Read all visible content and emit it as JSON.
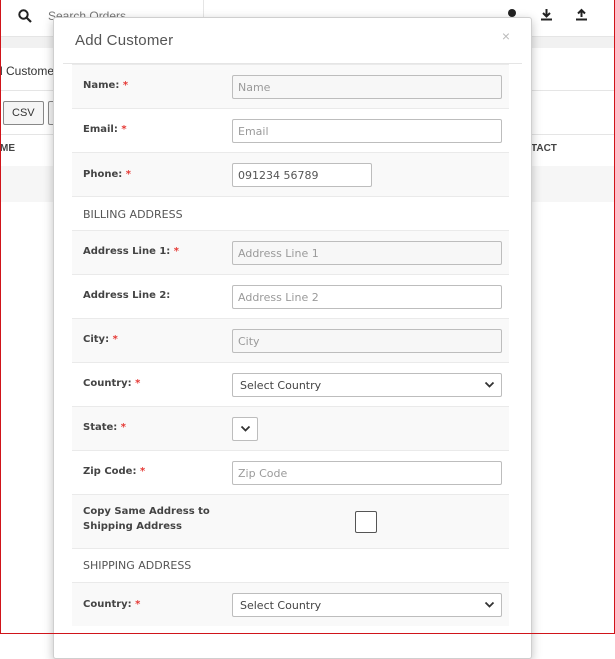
{
  "background": {
    "search_placeholder": "Search Orders",
    "title": "l Customers",
    "csv_button": "CSV",
    "col_name": "ME",
    "col_contact": "TACT"
  },
  "modal": {
    "title": "Add Customer",
    "close_glyph": "×",
    "fields": {
      "name": {
        "label": "Name:",
        "placeholder": "Name"
      },
      "email": {
        "label": "Email:",
        "placeholder": "Email"
      },
      "phone": {
        "label": "Phone:",
        "value": "091234 56789"
      }
    },
    "billing": {
      "section_title": "BILLING ADDRESS",
      "address1": {
        "label": "Address Line 1:",
        "placeholder": "Address Line 1"
      },
      "address2": {
        "label": "Address Line 2:",
        "placeholder": "Address Line 2"
      },
      "city": {
        "label": "City:",
        "placeholder": "City"
      },
      "country": {
        "label": "Country:",
        "selected": "Select Country"
      },
      "state": {
        "label": "State:"
      },
      "zip": {
        "label": "Zip Code:",
        "placeholder": "Zip Code"
      },
      "copy_label_line1": "Copy Same Address to",
      "copy_label_line2": "Shipping Address"
    },
    "shipping": {
      "section_title": "SHIPPING ADDRESS",
      "country": {
        "label": "Country:",
        "selected": "Select Country"
      }
    },
    "required_mark": "*"
  },
  "colors": {
    "frame_border": "#d0141a",
    "required": "#e53935"
  }
}
